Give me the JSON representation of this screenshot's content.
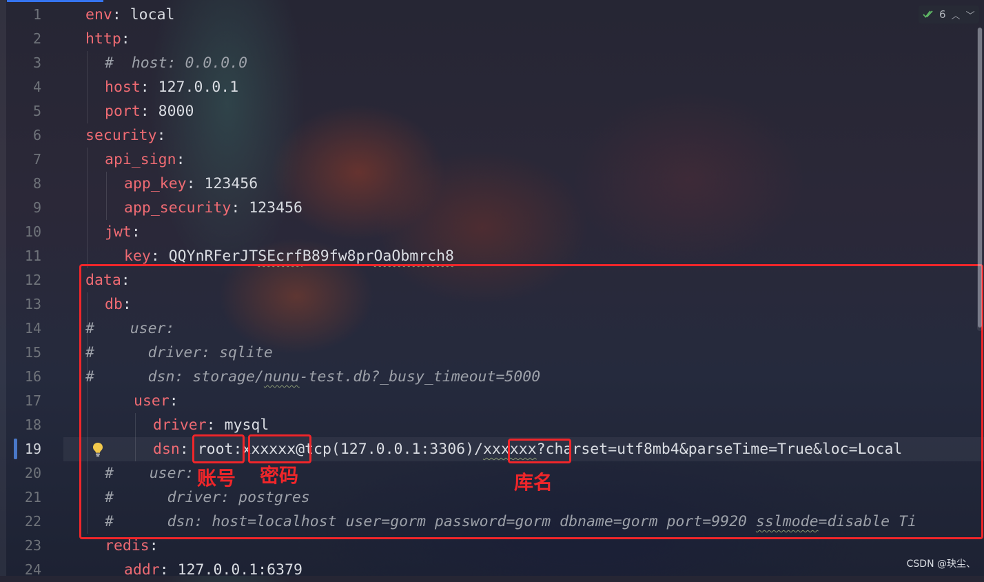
{
  "editor": {
    "inspection_count": "6",
    "current_line": "19",
    "line_numbers": [
      "1",
      "2",
      "3",
      "4",
      "5",
      "6",
      "7",
      "8",
      "9",
      "10",
      "11",
      "12",
      "13",
      "14",
      "15",
      "16",
      "17",
      "18",
      "19",
      "20",
      "21",
      "22",
      "23",
      "24"
    ],
    "lines": {
      "l1": {
        "key": "env",
        "value": "local"
      },
      "l2": {
        "key": "http"
      },
      "l3": {
        "comment": "#  host: 0.0.0.0"
      },
      "l4": {
        "key": "host",
        "value": "127.0.0.1"
      },
      "l5": {
        "key": "port",
        "value": "8000"
      },
      "l6": {
        "key": "security"
      },
      "l7": {
        "key": "api_sign"
      },
      "l8": {
        "key": "app_key",
        "value": "123456"
      },
      "l9": {
        "key": "app_security",
        "value": "123456"
      },
      "l10": {
        "key": "jwt"
      },
      "l11": {
        "key": "key",
        "value_a": "QQYnRFerJT",
        "value_b": "SEcrf",
        "value_c": "B89fw8pr",
        "value_d": "OaObmrch8"
      },
      "l12": {
        "key": "data"
      },
      "l13": {
        "key": "db"
      },
      "l14": {
        "comment": "#    user:"
      },
      "l15": {
        "comment": "#      driver: sqlite"
      },
      "l16": {
        "comment_a": "#      dsn: storage/",
        "comment_b": "nunu",
        "comment_c": "-test.db?_busy_timeout=5000"
      },
      "l17": {
        "key": "user"
      },
      "l18": {
        "key": "driver",
        "value": "mysql"
      },
      "l19": {
        "key": "dsn",
        "user": "root",
        "sep1": ":",
        "password": "xxxxxx",
        "mid": "@tcp(127.0.0.1:3306)/",
        "dbname": "xxxxxx",
        "tail": "?charset=utf8mb4&parseTime=True&loc=Local"
      },
      "l20": {
        "comment": "#    user:"
      },
      "l21": {
        "comment": "#      driver: postgres"
      },
      "l22": {
        "comment_a": "#      dsn: host=localhost user=gorm password=gorm dbname=gorm port=9920 ",
        "comment_b": "sslmode",
        "comment_c": "=disable Ti"
      },
      "l23": {
        "key": "redis"
      },
      "l24": {
        "key": "addr",
        "value": "127.0.0.1:6379"
      }
    }
  },
  "annotations": {
    "account_label": "账号",
    "password_label": "密码",
    "dbname_label": "库名",
    "color": "#f0262a"
  },
  "watermark": "CSDN @玦尘、"
}
